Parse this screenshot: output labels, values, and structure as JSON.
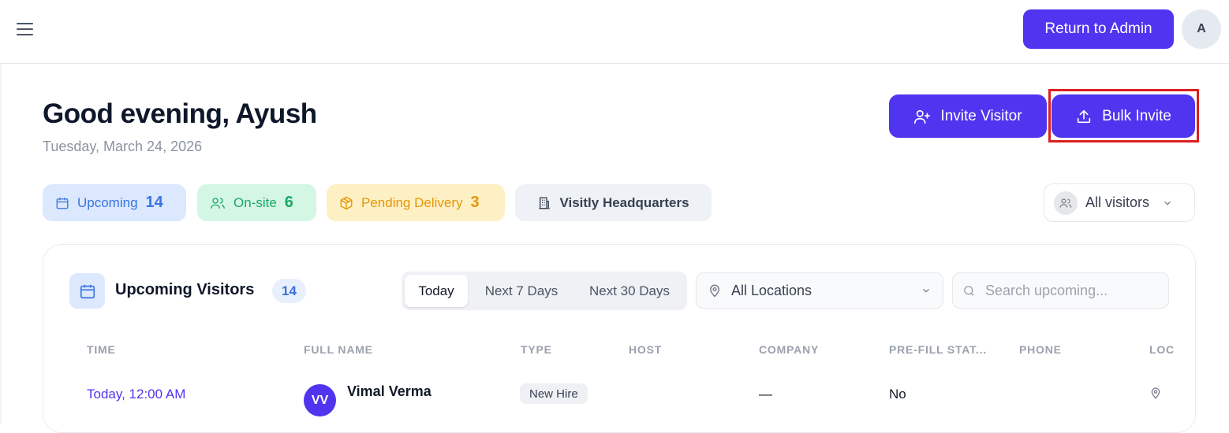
{
  "topbar": {
    "return_label": "Return to Admin",
    "avatar_initial": "A"
  },
  "header": {
    "greeting": "Good evening, Ayush",
    "date": "Tuesday, March 24, 2026",
    "invite_label": "Invite Visitor",
    "bulk_label": "Bulk Invite"
  },
  "stats": {
    "upcoming_label": "Upcoming",
    "upcoming_count": "14",
    "onsite_label": "On-site",
    "onsite_count": "6",
    "pending_label": "Pending Delivery",
    "pending_count": "3",
    "location_label": "Visitly Headquarters"
  },
  "visitor_filter": {
    "selected": "All visitors"
  },
  "upcoming_card": {
    "title": "Upcoming Visitors",
    "count": "14",
    "ranges": [
      "Today",
      "Next 7 Days",
      "Next 30 Days"
    ],
    "location_selected": "All Locations",
    "search_placeholder": "Search upcoming...",
    "columns": [
      "TIME",
      "FULL NAME",
      "TYPE",
      "HOST",
      "COMPANY",
      "PRE-FILL STAT...",
      "PHONE",
      "LOC"
    ],
    "rows": [
      {
        "time": "Today, 12:00 AM",
        "initials": "VV",
        "name": "Vimal Verma",
        "type": "New Hire",
        "host": "",
        "company": "—",
        "prefill": "No",
        "phone": ""
      }
    ]
  },
  "colors": {
    "primary": "#4f35f0",
    "highlight_border": "#dc2020",
    "upcoming_bg": "#dbe8fd",
    "onsite_bg": "#d4f6e4",
    "pending_bg": "#fdf0c4"
  }
}
